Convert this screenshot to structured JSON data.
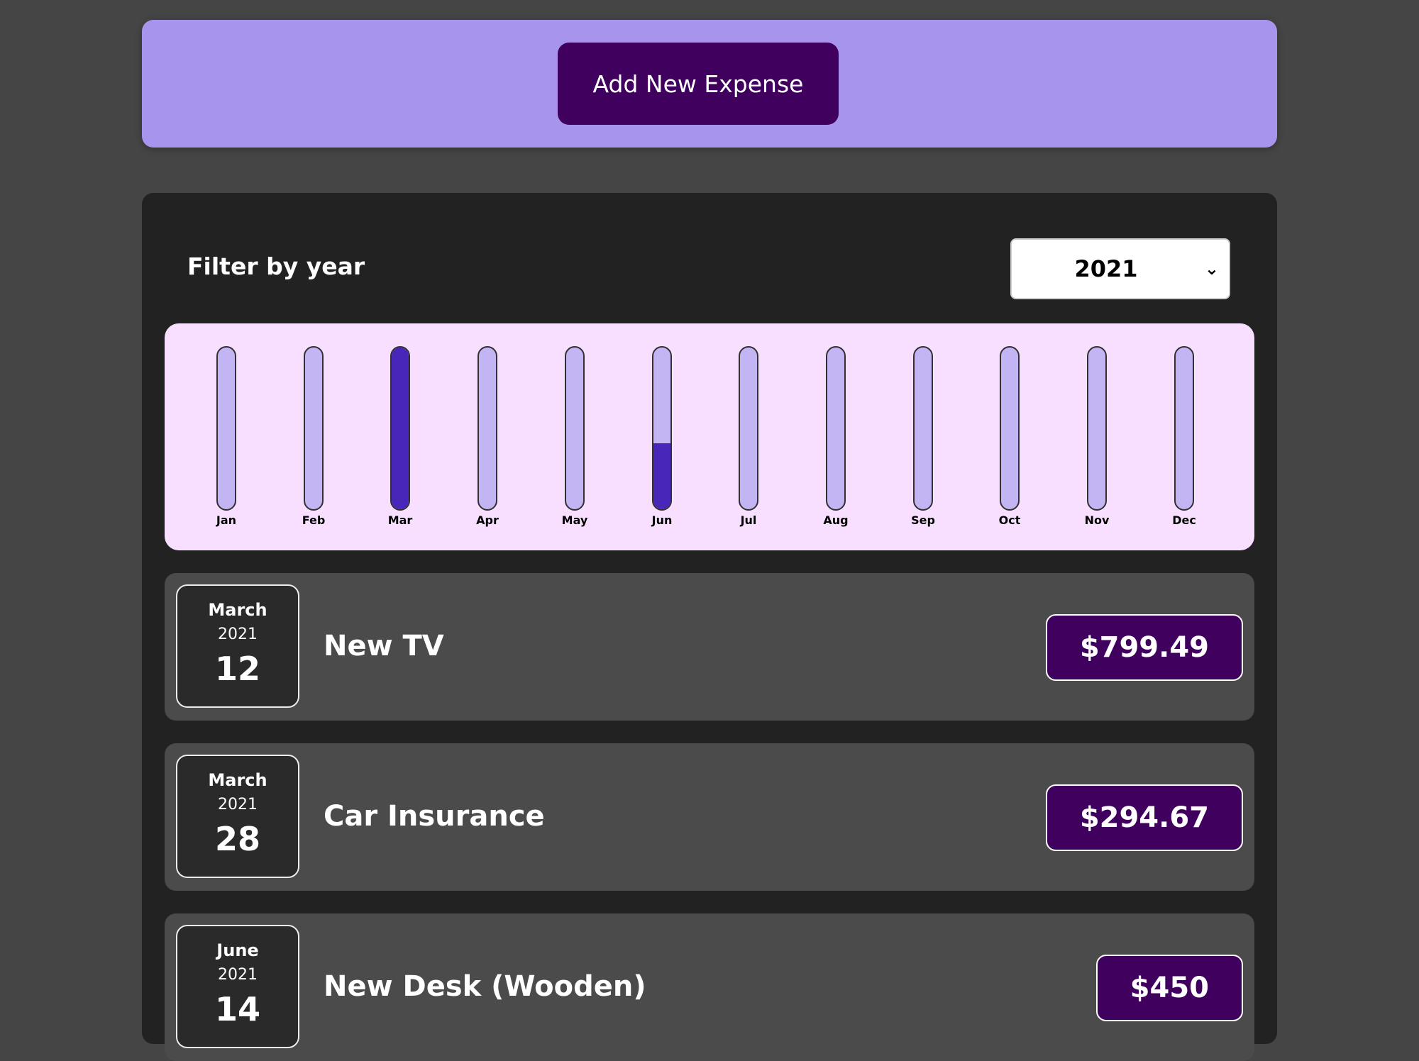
{
  "new_expense": {
    "button_label": "Add New Expense"
  },
  "filter": {
    "label": "Filter by year",
    "selected_year": "2021"
  },
  "chart_data": {
    "type": "bar",
    "categories": [
      "Jan",
      "Feb",
      "Mar",
      "Apr",
      "May",
      "Jun",
      "Jul",
      "Aug",
      "Sep",
      "Oct",
      "Nov",
      "Dec"
    ],
    "values": [
      0,
      0,
      1094.16,
      0,
      0,
      450,
      0,
      0,
      0,
      0,
      0,
      0
    ],
    "fill_fraction": [
      0,
      0,
      1,
      0,
      0,
      0.41,
      0,
      0,
      0,
      0,
      0,
      0
    ],
    "ylim": [
      0,
      1094.16
    ],
    "colors": {
      "track": "#c3b4f3",
      "fill": "#4826b9",
      "background": "#f8dfff"
    }
  },
  "expenses": [
    {
      "month": "March",
      "year": "2021",
      "day": "12",
      "title": "New TV",
      "amount": "$799.49"
    },
    {
      "month": "March",
      "year": "2021",
      "day": "28",
      "title": "Car Insurance",
      "amount": "$294.67"
    },
    {
      "month": "June",
      "year": "2021",
      "day": "14",
      "title": "New Desk (Wooden)",
      "amount": "$450"
    }
  ],
  "colors": {
    "page_bg": "#454545",
    "header_bg": "#a794ec",
    "button_bg": "#40005d",
    "panel_bg": "#222222",
    "item_bg": "#4b4b4b"
  }
}
